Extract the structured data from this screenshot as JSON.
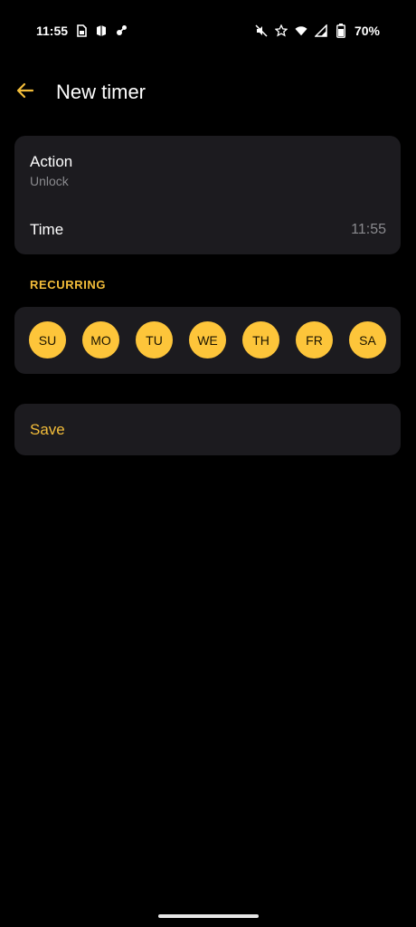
{
  "status_bar": {
    "time": "11:55",
    "battery": "70%",
    "left_icons": [
      "sim-card-icon",
      "app-notification-icon",
      "settings-notification-icon"
    ],
    "right_icons": [
      "mute-icon",
      "star-icon",
      "wifi-icon",
      "signal-icon",
      "battery-icon"
    ]
  },
  "header": {
    "title": "New timer",
    "back_icon": "arrow-left-icon"
  },
  "action_card": {
    "action_label": "Action",
    "action_value": "Unlock",
    "time_label": "Time",
    "time_value": "11:55"
  },
  "recurring": {
    "section_label": "RECURRING",
    "days": [
      "SU",
      "MO",
      "TU",
      "WE",
      "TH",
      "FR",
      "SA"
    ]
  },
  "save": {
    "label": "Save"
  },
  "colors": {
    "accent": "#f3bd3a",
    "day_fill": "#fdc53a",
    "card_bg": "#1c1b1f",
    "background": "#000000",
    "secondary_text": "#8a8a8e"
  }
}
